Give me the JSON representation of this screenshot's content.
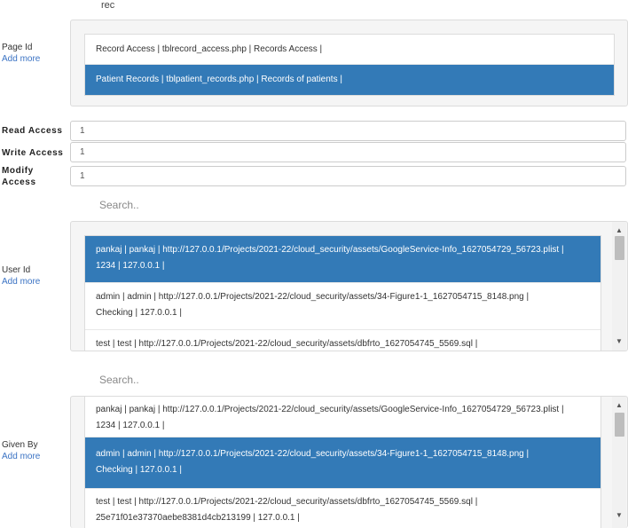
{
  "top_text": "rec",
  "page_id": {
    "label": "Page Id",
    "add_more": "Add more",
    "options": [
      "Record Access | tblrecord_access.php | Records Access |",
      "Patient Records | tblpatient_records.php | Records of patients |"
    ],
    "selected_index": 1
  },
  "read_access": {
    "label": "Read Access",
    "value": "1"
  },
  "write_access": {
    "label": "Write Access",
    "value": "1"
  },
  "modify_access": {
    "label_line1": "Modify",
    "label_line2": "Access",
    "value": "1"
  },
  "user_id": {
    "label": "User Id",
    "add_more": "Add more",
    "search_placeholder": "Search..",
    "options": [
      {
        "line1": "pankaj | pankaj | http://127.0.0.1/Projects/2021-22/cloud_security/assets/GoogleService-Info_1627054729_56723.plist |",
        "line2": "1234 | 127.0.0.1 |"
      },
      {
        "line1": "admin | admin | http://127.0.0.1/Projects/2021-22/cloud_security/assets/34-Figure1-1_1627054715_8148.png |",
        "line2": "Checking | 127.0.0.1 |"
      },
      {
        "line1": "test | test | http://127.0.0.1/Projects/2021-22/cloud_security/assets/dbfrto_1627054745_5569.sql |",
        "line2": ""
      }
    ],
    "selected_index": 0
  },
  "given_by": {
    "label": "Given By",
    "add_more": "Add more",
    "search_placeholder": "Search..",
    "options": [
      {
        "line1": "pankaj | pankaj | http://127.0.0.1/Projects/2021-22/cloud_security/assets/GoogleService-Info_1627054729_56723.plist |",
        "line2": "1234 | 127.0.0.1 |"
      },
      {
        "line1": "admin | admin | http://127.0.0.1/Projects/2021-22/cloud_security/assets/34-Figure1-1_1627054715_8148.png |",
        "line2": "Checking | 127.0.0.1 |"
      },
      {
        "line1": "test | test | http://127.0.0.1/Projects/2021-22/cloud_security/assets/dbfrto_1627054745_5569.sql |",
        "line2": "25e71f01e37370aebe8381d4cb213199 | 127.0.0.1 |"
      }
    ],
    "selected_index": 1
  },
  "colors": {
    "selected": "#337ab7",
    "link": "#3b73c4"
  },
  "icons": {
    "scroll_up": "triangle-up-icon",
    "scroll_down": "triangle-down-icon"
  }
}
